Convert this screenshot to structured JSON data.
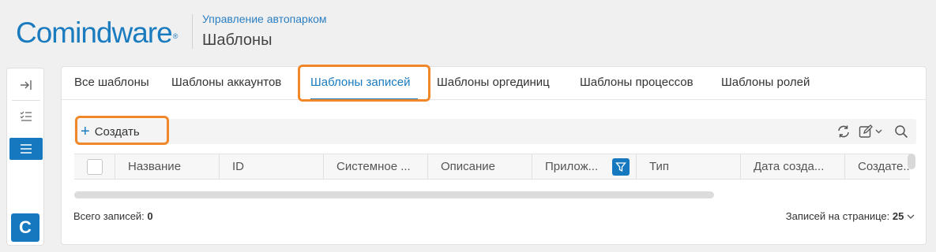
{
  "header": {
    "logo_text": "Comindware",
    "logo_mark": "®",
    "breadcrumb": "Управление автопарком",
    "title": "Шаблоны"
  },
  "sidebar": {
    "icons": [
      "collapse-icon",
      "tasks-list-icon",
      "menu-icon"
    ],
    "app_badge": "C"
  },
  "tabs": [
    {
      "label": "Все шаблоны",
      "active": false
    },
    {
      "label": "Шаблоны аккаунтов",
      "active": false
    },
    {
      "label": "Шаблоны записей",
      "active": true
    },
    {
      "label": "Шаблоны оргединиц",
      "active": false
    },
    {
      "label": "Шаблоны процессов",
      "active": false
    },
    {
      "label": "Шаблоны ролей",
      "active": false
    }
  ],
  "toolbar": {
    "create_label": "Создать",
    "icons": [
      "refresh-icon",
      "edit-icon",
      "search-icon"
    ]
  },
  "table": {
    "columns": [
      "Название",
      "ID",
      "Системное ...",
      "Описание",
      "Прилож...",
      "Тип",
      "Дата созда...",
      "Создате..."
    ],
    "rows": []
  },
  "footer": {
    "total_label": "Всего записей:",
    "total_value": "0",
    "per_page_label": "Записей на странице:",
    "per_page_value": "25"
  },
  "colors": {
    "accent": "#1a7bbf",
    "highlight": "#f0882a"
  }
}
